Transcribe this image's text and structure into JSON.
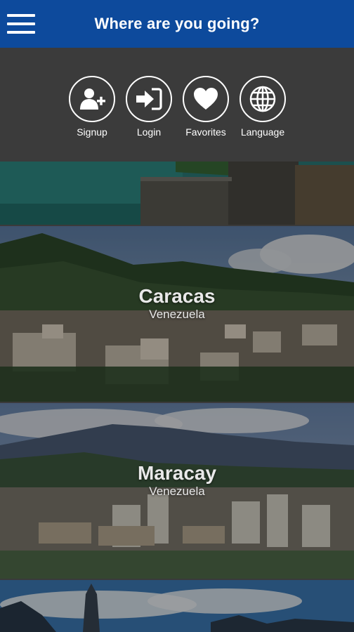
{
  "header": {
    "title": "Where are you going?",
    "menu_icon": "hamburger-menu-icon"
  },
  "actions": [
    {
      "label": "Signup",
      "icon": "add-user-icon"
    },
    {
      "label": "Login",
      "icon": "login-icon"
    },
    {
      "label": "Favorites",
      "icon": "heart-icon"
    },
    {
      "label": "Language",
      "icon": "globe-icon"
    }
  ],
  "destinations": [
    {
      "name": "Caracas",
      "country": "Venezuela"
    },
    {
      "name": "Maracay",
      "country": "Venezuela"
    }
  ],
  "colors": {
    "header_bg": "#0d4a9c",
    "actions_bg": "#3b3b3b"
  }
}
